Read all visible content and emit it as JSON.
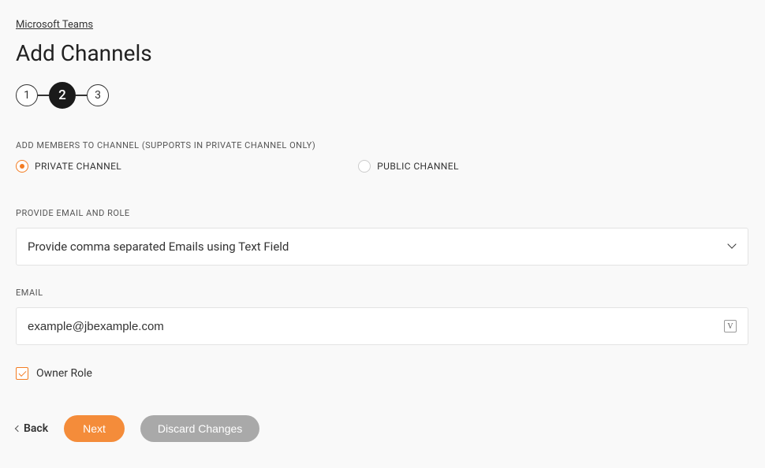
{
  "breadcrumb": "Microsoft Teams",
  "title": "Add Channels",
  "stepper": {
    "steps": [
      "1",
      "2",
      "3"
    ],
    "active_index": 1
  },
  "sections": {
    "members_label": "ADD MEMBERS TO CHANNEL (SUPPORTS IN PRIVATE CHANNEL ONLY)",
    "channel_type": {
      "private_label": "PRIVATE CHANNEL",
      "public_label": "PUBLIC CHANNEL",
      "selected": "private"
    },
    "email_role_label": "PROVIDE EMAIL AND ROLE",
    "email_role_select_value": "Provide comma separated Emails using Text Field",
    "email_label": "EMAIL",
    "email_value": "example@jbexample.com",
    "input_badge": "V",
    "owner_checkbox": {
      "label": "Owner Role",
      "checked": true
    }
  },
  "buttons": {
    "back": "Back",
    "next": "Next",
    "discard": "Discard Changes"
  }
}
